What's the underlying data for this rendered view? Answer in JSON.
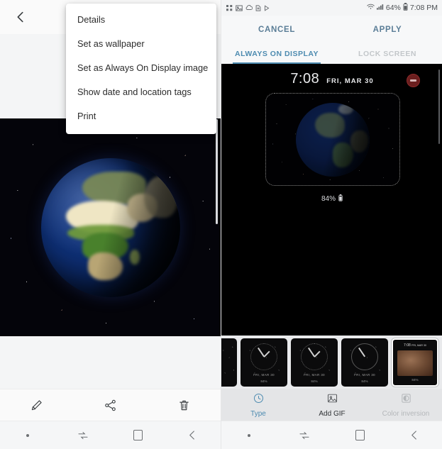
{
  "left_panel": {
    "name": "gallery-viewer",
    "topbar": {
      "back_icon": "chevron-left-icon"
    },
    "menu": {
      "name": "overflow-menu",
      "items": [
        {
          "label": "Details",
          "icon": "info-icon"
        },
        {
          "label": "Set as wallpaper",
          "icon": "wallpaper-icon"
        },
        {
          "label": "Set as Always On Display image",
          "icon": "aod-icon"
        },
        {
          "label": "Show date and location tags",
          "icon": "tag-icon"
        },
        {
          "label": "Print",
          "icon": "printer-icon"
        }
      ]
    },
    "photo": {
      "alt": "earth-globe-photo",
      "subject": "Earth globe over starfield showing Africa and Europe"
    },
    "bottom_toolbar": {
      "items": [
        {
          "icon": "pencil-icon",
          "label": "Edit"
        },
        {
          "icon": "share-icon",
          "label": "Share"
        },
        {
          "icon": "trash-icon",
          "label": "Delete"
        }
      ]
    },
    "navbar": {
      "items": [
        {
          "icon": "dot-icon"
        },
        {
          "icon": "recents-icon"
        },
        {
          "icon": "home-square-icon"
        },
        {
          "icon": "back-arrow-icon"
        }
      ]
    }
  },
  "right_panel": {
    "name": "always-on-display-editor",
    "statusbar": {
      "notification_icons": [
        "apps-grid-icon",
        "image-icon",
        "cloud-icon",
        "document-icon",
        "play-icon"
      ],
      "wifi_icon": "wifi-icon",
      "signal_icon": "signal-bars-icon",
      "battery_percent": "64%",
      "battery_icon": "battery-icon",
      "clock": "7:08 PM"
    },
    "action_bar": {
      "cancel_label": "CANCEL",
      "apply_label": "APPLY",
      "accent": "#5b7e97"
    },
    "tabs": [
      {
        "label": "ALWAYS ON DISPLAY",
        "active": true
      },
      {
        "label": "LOCK SCREEN",
        "active": false
      }
    ],
    "tab_accent": "#4d8bb0",
    "preview": {
      "time": "7:08",
      "date": "FRI, MAR 30",
      "battery_percent": "84%",
      "battery_icon": "battery-icon",
      "remove_icon": "minus-circle-icon",
      "remove_color": "#6b1f1f",
      "image_alt": "earth-globe-gif",
      "frame_style": "dotted"
    },
    "thumbnails": [
      {
        "type": "analog-clock",
        "style": "clipped",
        "meta": "",
        "battery": "",
        "selected": false
      },
      {
        "type": "analog-clock",
        "style": "dotted",
        "meta": "FRI, MAR 30",
        "battery": "84%",
        "selected": false
      },
      {
        "type": "analog-clock",
        "style": "numbers",
        "meta": "FRI, MAR 30",
        "battery": "84%",
        "selected": false
      },
      {
        "type": "analog-clock",
        "style": "ring",
        "meta": "FRI, MAR 30",
        "battery": "84%",
        "selected": false
      },
      {
        "type": "image-clock",
        "style": "gif",
        "time": "7:08",
        "date": "FRI, MAR 30",
        "battery": "84%",
        "selected": true
      }
    ],
    "edit_bar": {
      "items": [
        {
          "label": "Type",
          "icon": "clock-icon",
          "state": "active"
        },
        {
          "label": "Add GIF",
          "icon": "image-icon",
          "state": "normal"
        },
        {
          "label": "Color inversion",
          "icon": "contrast-icon",
          "state": "disabled"
        }
      ]
    },
    "navbar": {
      "items": [
        {
          "icon": "dot-icon"
        },
        {
          "icon": "recents-icon"
        },
        {
          "icon": "home-square-icon"
        },
        {
          "icon": "back-arrow-icon"
        }
      ]
    }
  }
}
